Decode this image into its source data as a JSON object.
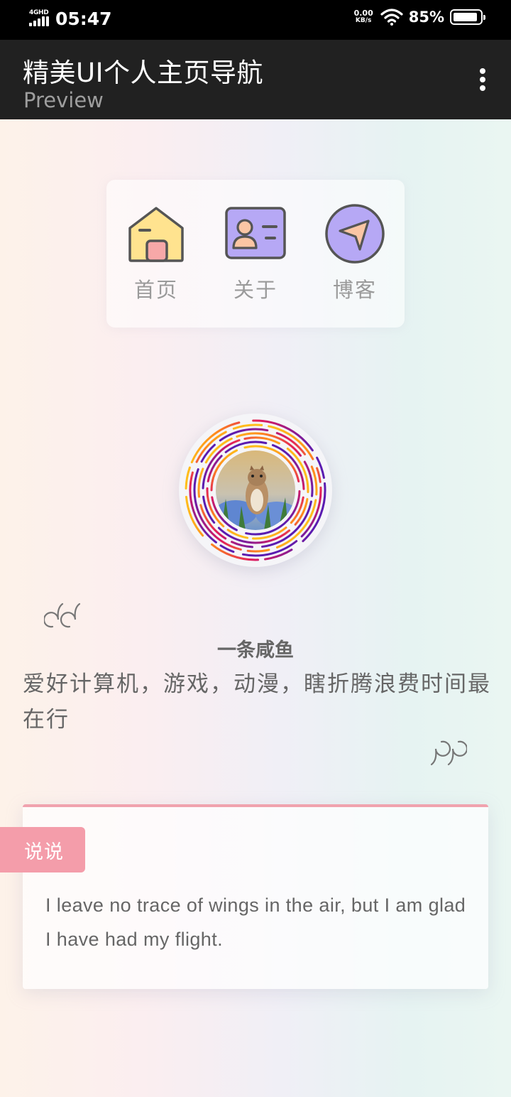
{
  "status_bar": {
    "network_type": "4GHD",
    "time": "05:47",
    "net_speed_value": "0.00",
    "net_speed_unit": "KB/s",
    "battery_percent": "85%"
  },
  "app_bar": {
    "title": "精美UI个人主页导航",
    "subtitle": "Preview"
  },
  "nav": {
    "items": [
      {
        "label": "首页",
        "icon": "home-icon"
      },
      {
        "label": "关于",
        "icon": "id-card-icon"
      },
      {
        "label": "博客",
        "icon": "send-icon"
      }
    ]
  },
  "profile": {
    "name": "一条咸鱼",
    "bio": "爱好计算机，游戏，动漫，瞎折腾浪费时间最在行"
  },
  "shuoshuo": {
    "tag": "说说",
    "text": "I leave no trace of wings in the air, but I am glad I have had my flight."
  },
  "colors": {
    "app_bar_bg": "#212121",
    "tag_pink": "#f49daa",
    "card_border": "#f0a2ae",
    "text_gray": "#666666"
  }
}
